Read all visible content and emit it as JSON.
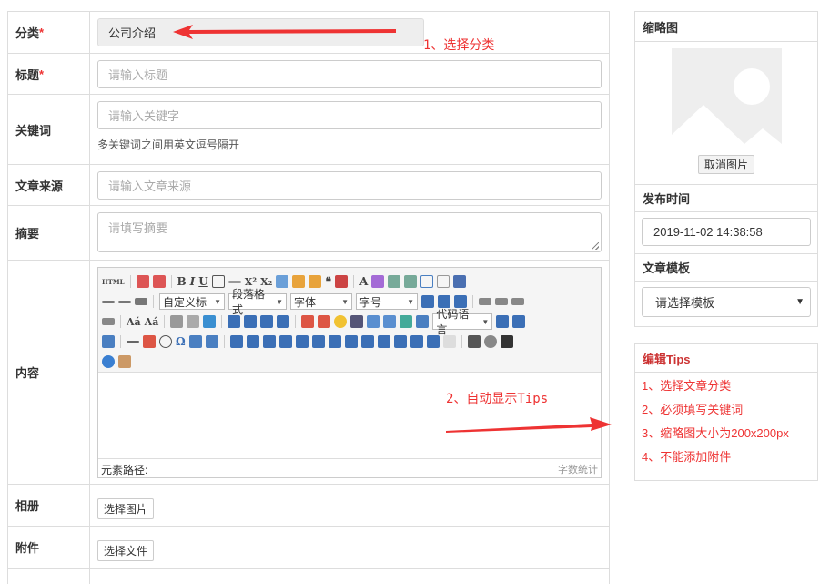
{
  "form": {
    "category": {
      "label": "分类",
      "required_mark": "*",
      "value": "公司介绍"
    },
    "title": {
      "label": "标题",
      "required_mark": "*",
      "placeholder": "请输入标题"
    },
    "keywords": {
      "label": "关键词",
      "placeholder": "请输入关键字",
      "hint": "多关键词之间用英文逗号隔开"
    },
    "source": {
      "label": "文章来源",
      "placeholder": "请输入文章来源"
    },
    "summary": {
      "label": "摘要",
      "placeholder": "请填写摘要"
    },
    "content": {
      "label": "内容",
      "toolbar": {
        "html_label": "HTML",
        "custom_title": "自定义标",
        "paragraph_format": "段落格式",
        "font_family": "字体",
        "font_size": "字号",
        "code_language": "代码语言"
      },
      "path_label": "元素路径:",
      "word_count": "字数统计"
    },
    "album": {
      "label": "相册",
      "button": "选择图片"
    },
    "attachment": {
      "label": "附件",
      "button": "选择文件"
    }
  },
  "annotations": {
    "step1": "1、选择分类",
    "step2": "2、自动显示Tips"
  },
  "sidebar": {
    "thumbnail": {
      "title": "缩略图",
      "cancel_button": "取消图片"
    },
    "publish_time": {
      "title": "发布时间",
      "value": "2019-11-02 14:38:58"
    },
    "template": {
      "title": "文章模板",
      "selected": "请选择模板"
    },
    "tips": {
      "title": "编辑Tips",
      "items": [
        "1、选择文章分类",
        "2、必须填写关键词",
        "3、缩略图大小为200x200px",
        "4、不能添加附件"
      ]
    }
  },
  "colors": {
    "accent_red": "#e33333",
    "border": "#dddddd"
  }
}
